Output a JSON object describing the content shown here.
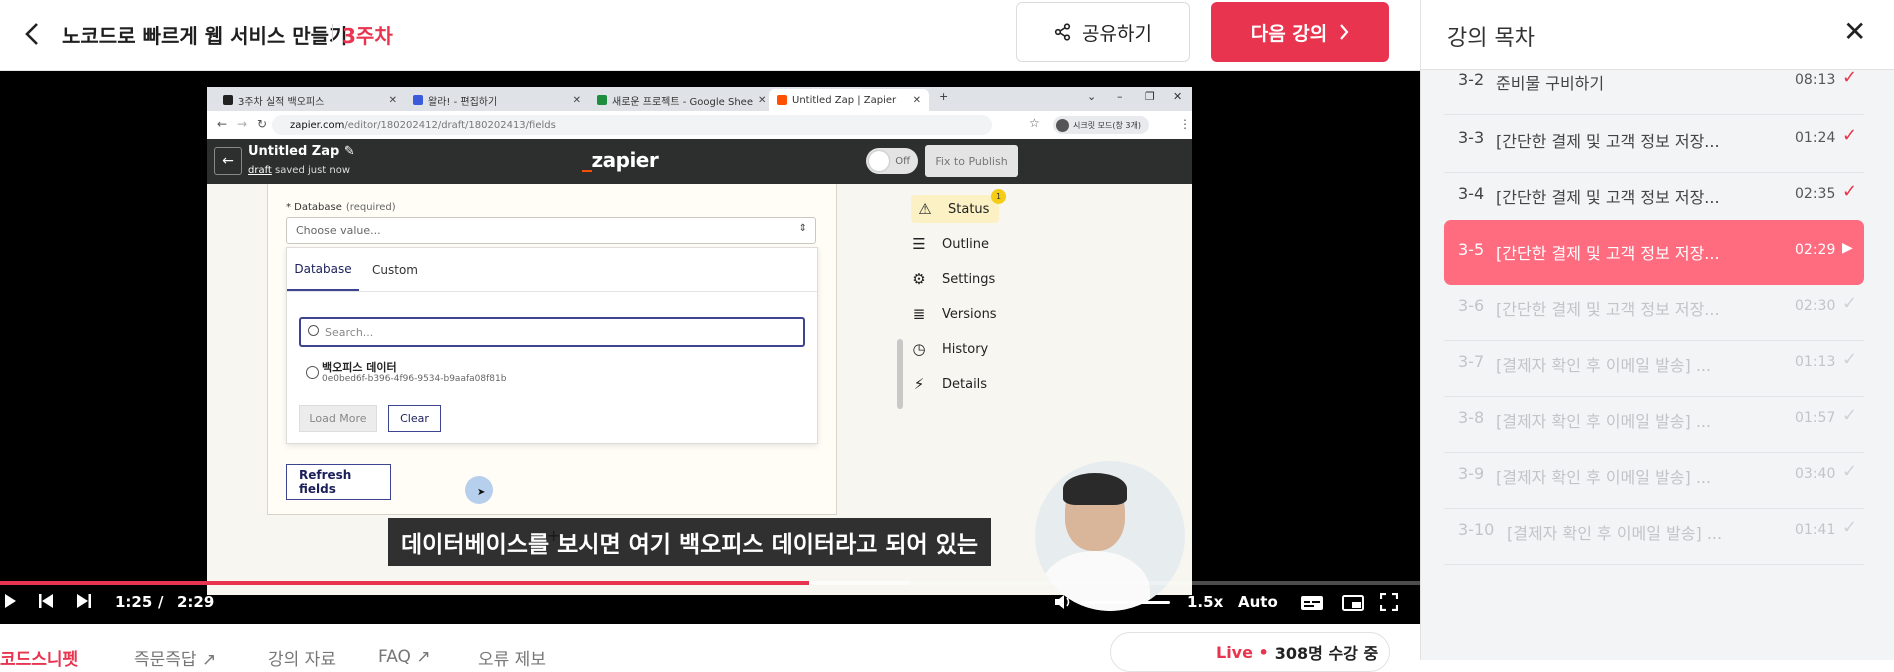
{
  "header": {
    "course_title": "노코드로 빠르게 웹 서비스 만들기",
    "week": "3주차",
    "share_label": "공유하기",
    "next_label": "다음 강의"
  },
  "browser": {
    "tabs": [
      {
        "label": "3주차 실적 백오피스",
        "favicon_color": "#222222"
      },
      {
        "label": "왈라! - 편집하기",
        "favicon_color": "#3b5bdb"
      },
      {
        "label": "새로운 프로젝트 - Google Shee",
        "favicon_color": "#1e8e3e"
      },
      {
        "label": "Untitled Zap | Zapier",
        "favicon_color": "#ff4f00"
      }
    ],
    "url_domain": "zapier.com",
    "url_path": "/editor/180202412/draft/180202413/fields",
    "secret_mode": "시크릿 모드(창 3개)"
  },
  "zapier": {
    "zap_name": "Untitled Zap",
    "draft_word": "draft",
    "saved_text": "saved just now",
    "logo": "zapier",
    "toggle_label": "Off",
    "publish_label": "Fix to Publish",
    "database_label": "* Database",
    "database_required": "(required)",
    "select_placeholder": "Choose value...",
    "dropdown_tabs": [
      "Database",
      "Custom"
    ],
    "search_placeholder": "Search...",
    "option_title": "백오피스 데이터",
    "option_id": "0e0bed6f-b396-4f96-9534-b9aafa08f81b",
    "load_more_label": "Load More",
    "clear_label": "Clear",
    "refresh_label": "Refresh fields",
    "side_menu": [
      {
        "label": "Status",
        "icon": "warning-icon",
        "glyph": "⚠"
      },
      {
        "label": "Outline",
        "icon": "list-icon",
        "glyph": "☰"
      },
      {
        "label": "Settings",
        "icon": "gear-icon",
        "glyph": "⚙"
      },
      {
        "label": "Versions",
        "icon": "stack-icon",
        "glyph": "≣"
      },
      {
        "label": "History",
        "icon": "clock-icon",
        "glyph": "◷"
      },
      {
        "label": "Details",
        "icon": "file-bolt-icon",
        "glyph": "⚡"
      }
    ],
    "status_badge": "1"
  },
  "video": {
    "subtitle": "데이터베이스를 보시면 여기 백오피스 데이터라고 되어 있는",
    "current_time": "1:25",
    "separator": "/",
    "duration": "2:29",
    "progress_fraction": 0.57,
    "buffered_fraction": 0.64,
    "speed": "1.5x",
    "quality": "Auto"
  },
  "below_tabs": [
    {
      "label": "코드스니펫",
      "active": true
    },
    {
      "label": "즉문즉답 ↗",
      "active": false
    },
    {
      "label": "강의 자료",
      "active": false
    },
    {
      "label": "FAQ ↗",
      "active": false
    },
    {
      "label": "오류 제보",
      "active": false
    }
  ],
  "live": {
    "label": "Live •",
    "count_text": "308명 수강 중"
  },
  "toc": {
    "title": "강의 목차",
    "items": [
      {
        "num": "3-2",
        "title": "준비물 구비하기",
        "duration": "08:13",
        "state": "done"
      },
      {
        "num": "3-3",
        "title": "[간단한 결제 및 고객 정보 저장...",
        "duration": "01:24",
        "state": "done"
      },
      {
        "num": "3-4",
        "title": "[간단한 결제 및 고객 정보 저장...",
        "duration": "02:35",
        "state": "done"
      },
      {
        "num": "3-5",
        "title": "[간단한 결제 및 고객 정보 저장...",
        "duration": "02:29",
        "state": "current"
      },
      {
        "num": "3-6",
        "title": "[간단한 결제 및 고객 정보 저장...",
        "duration": "02:30",
        "state": "locked"
      },
      {
        "num": "3-7",
        "title": "[결제자 확인 후 이메일 발송] ...",
        "duration": "01:13",
        "state": "locked"
      },
      {
        "num": "3-8",
        "title": "[결제자 확인 후 이메일 발송] ...",
        "duration": "01:57",
        "state": "locked"
      },
      {
        "num": "3-9",
        "title": "[결제자 확인 후 이메일 발송] ...",
        "duration": "03:40",
        "state": "locked"
      },
      {
        "num": "3-10",
        "title": "[결제자 확인 후 이메일 발송] ...",
        "duration": "01:41",
        "state": "locked"
      }
    ]
  },
  "colors": {
    "accent": "#e8344e",
    "current_item": "#ff6b7f",
    "zapier_orange": "#ff4f00"
  }
}
